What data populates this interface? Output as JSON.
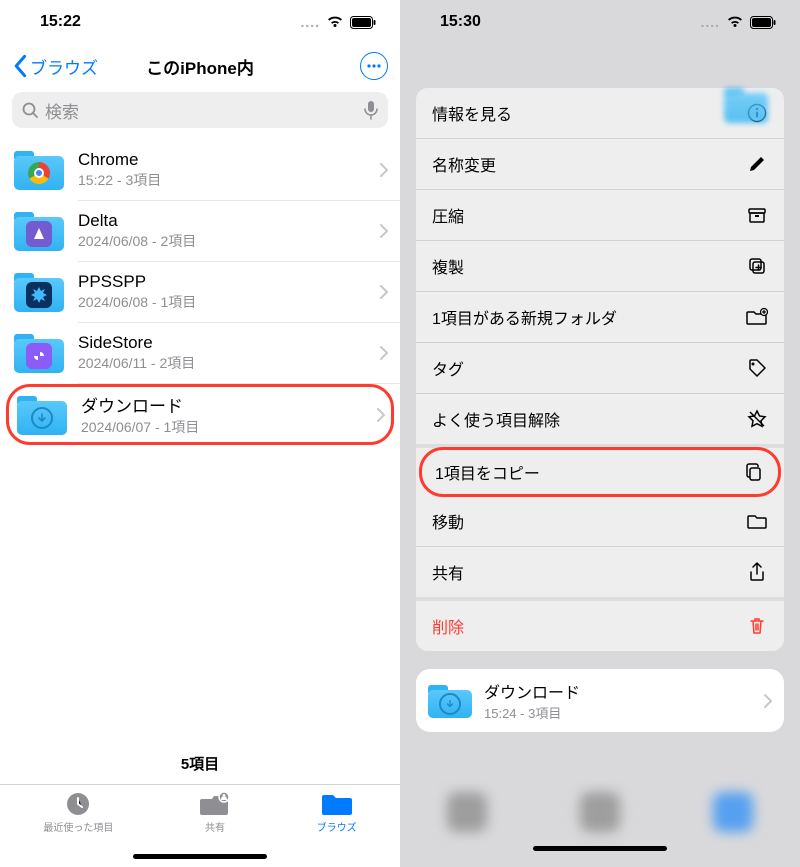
{
  "left": {
    "time": "15:22",
    "back_label": "ブラウズ",
    "title": "このiPhone内",
    "search_placeholder": "検索",
    "folders": [
      {
        "name": "Chrome",
        "meta": "15:22 - 3項目"
      },
      {
        "name": "Delta",
        "meta": "2024/06/08 - 2項目"
      },
      {
        "name": "PPSSPP",
        "meta": "2024/06/08 - 1項目"
      },
      {
        "name": "SideStore",
        "meta": "2024/06/11 - 2項目"
      },
      {
        "name": "ダウンロード",
        "meta": "2024/06/07 - 1項目"
      }
    ],
    "item_count": "5項目",
    "tabs": [
      {
        "label": "最近使った項目"
      },
      {
        "label": "共有"
      },
      {
        "label": "ブラウズ"
      }
    ]
  },
  "right": {
    "time": "15:30",
    "menu": [
      {
        "label": "情報を見る"
      },
      {
        "label": "名称変更"
      },
      {
        "label": "圧縮"
      },
      {
        "label": "複製"
      },
      {
        "label": "1項目がある新規フォルダ"
      },
      {
        "label": "タグ"
      },
      {
        "label": "よく使う項目解除"
      },
      {
        "label": "1項目をコピー"
      },
      {
        "label": "移動"
      },
      {
        "label": "共有"
      },
      {
        "label": "削除"
      }
    ],
    "card": {
      "name": "ダウンロード",
      "meta": "15:24 - 3項目"
    }
  }
}
